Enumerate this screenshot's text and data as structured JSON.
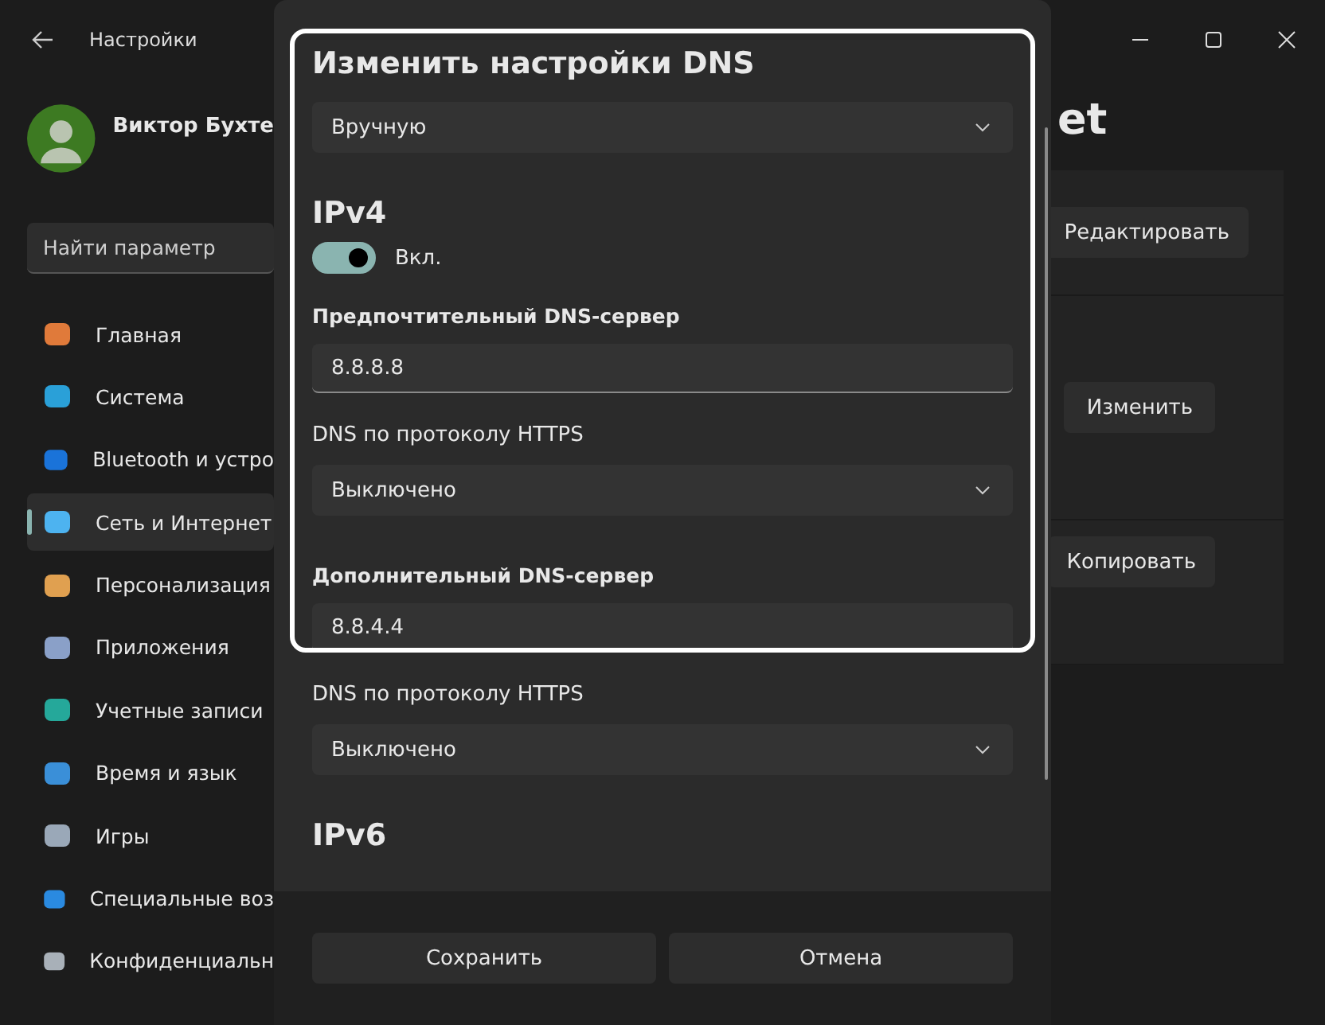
{
  "window": {
    "title": "Настройки"
  },
  "profile": {
    "name": "Виктор Бухте"
  },
  "search": {
    "placeholder": "Найти параметр"
  },
  "sidebar": {
    "items": [
      {
        "label": "Главная",
        "selected": false
      },
      {
        "label": "Система",
        "selected": false
      },
      {
        "label": "Bluetooth и устро",
        "selected": false
      },
      {
        "label": "Сеть и Интернет",
        "selected": true
      },
      {
        "label": "Персонализация",
        "selected": false
      },
      {
        "label": "Приложения",
        "selected": false
      },
      {
        "label": "Учетные записи",
        "selected": false
      },
      {
        "label": "Время и язык",
        "selected": false
      },
      {
        "label": "Игры",
        "selected": false
      },
      {
        "label": "Специальные воз",
        "selected": false
      },
      {
        "label": "Конфиденциальн",
        "selected": false
      }
    ]
  },
  "page": {
    "title": "et",
    "buttons": [
      "Редактировать",
      "Изменить",
      "Копировать"
    ]
  },
  "dialog": {
    "title": "Изменить настройки DNS",
    "mode": "Вручную",
    "sections": [
      {
        "heading": "IPv4",
        "toggle": {
          "on": true,
          "label": "Вкл."
        },
        "servers": [
          {
            "label": "Предпочтительный DNS-сервер",
            "value": "8.8.8.8",
            "https_label": "DNS по протоколу HTTPS",
            "https_value": "Выключено"
          },
          {
            "label": "Дополнительный DNS-сервер",
            "value": "8.8.4.4",
            "https_label": "DNS по протоколу HTTPS",
            "https_value": "Выключено"
          }
        ]
      },
      {
        "heading": "IPv6"
      }
    ],
    "buttons": [
      "Сохранить",
      "Отмена"
    ]
  }
}
